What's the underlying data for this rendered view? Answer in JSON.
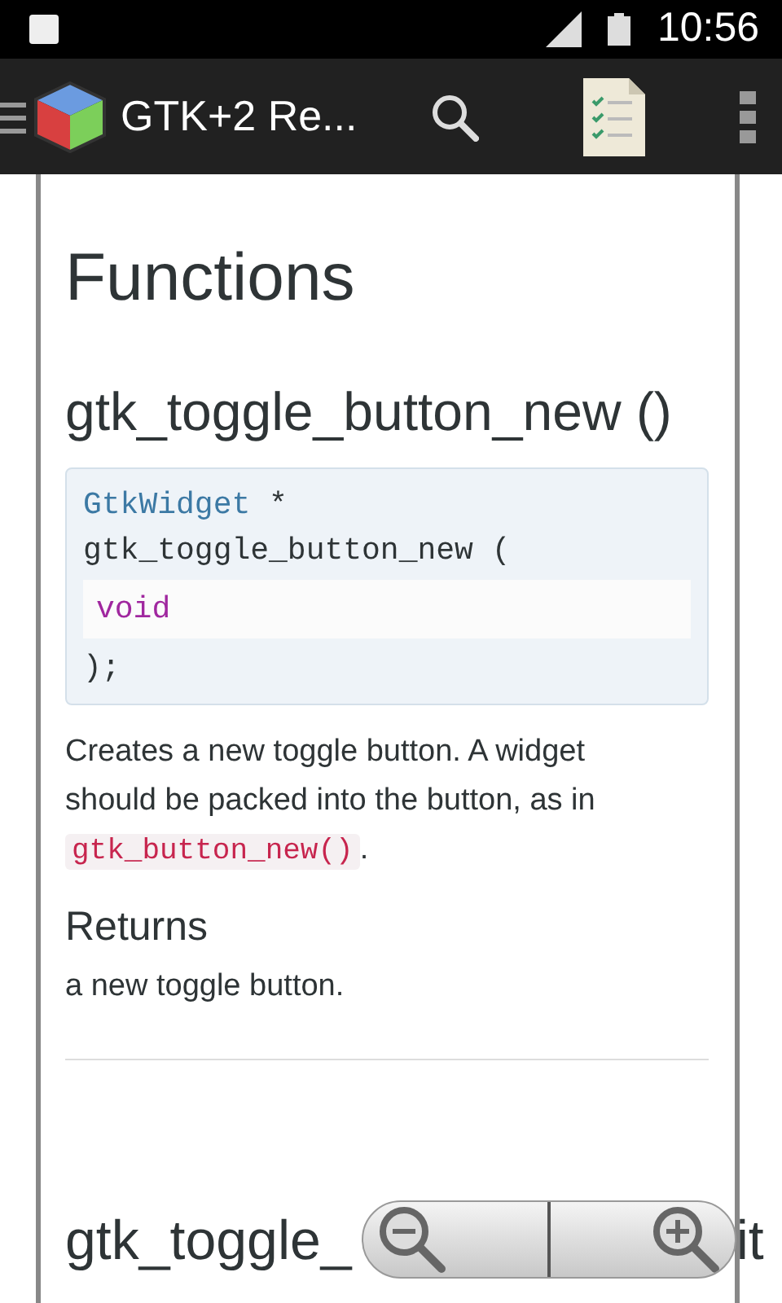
{
  "status_bar": {
    "time": "10:56"
  },
  "app_bar": {
    "title": "GTK+2 Re..."
  },
  "content": {
    "section_title": "Functions",
    "function": {
      "name": "gtk_toggle_button_new ()",
      "signature": {
        "return_type": "GtkWidget",
        "pointer": "*",
        "call": "gtk_toggle_button_new (",
        "params": [
          "void"
        ],
        "close": ");"
      },
      "description": [
        {
          "kind": "text",
          "text": "Creates a new toggle button. A widget should be packed into the button, as in "
        },
        {
          "kind": "code",
          "text": "gtk_button_new()"
        },
        {
          "kind": "text",
          "text": "."
        }
      ],
      "returns_title": "Returns",
      "returns_text": "a new toggle button."
    },
    "next_function": {
      "name_start": "gtk_toggle_",
      "name_end": "it"
    }
  }
}
